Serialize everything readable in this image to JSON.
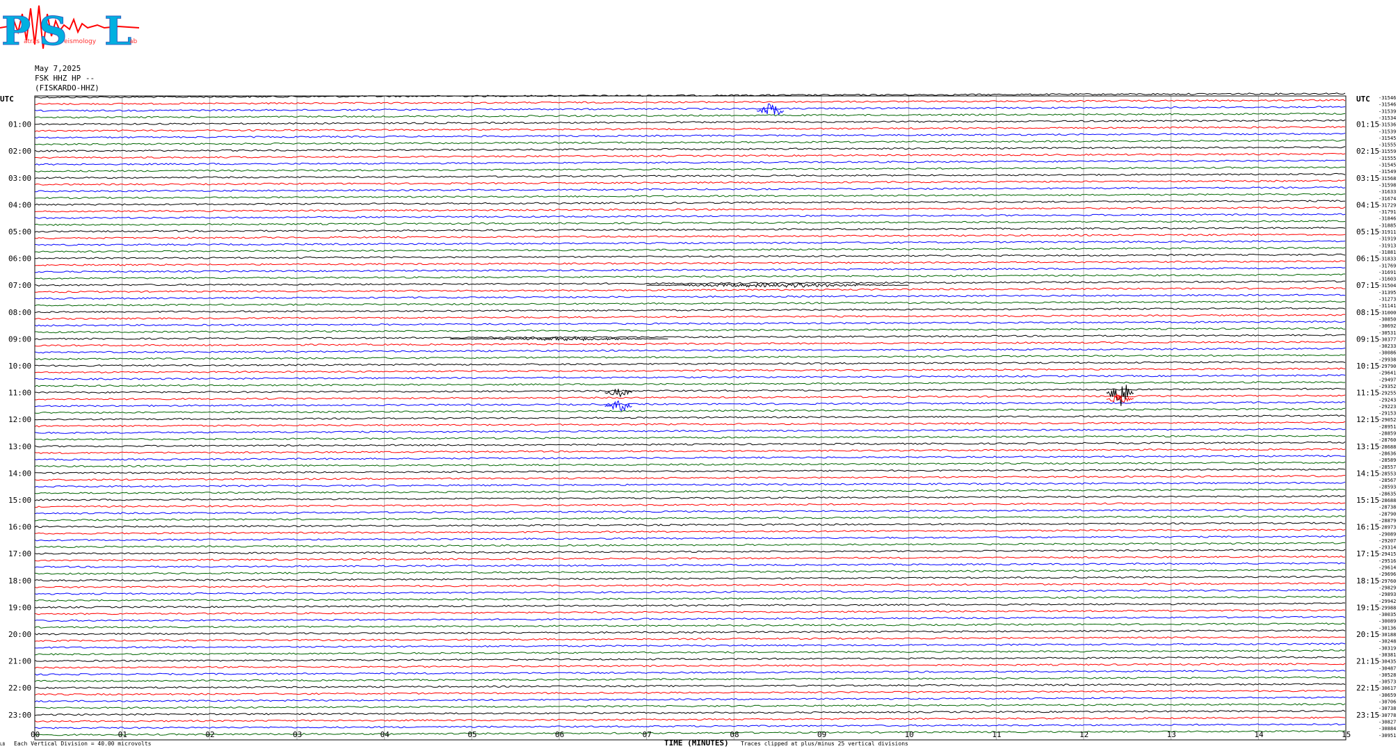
{
  "header": {
    "logo_letters": [
      "P",
      "S",
      "L"
    ],
    "logo_sub": [
      "atras",
      "eismology",
      "ab"
    ],
    "date": "May 7,2025",
    "channel": "FSK HHZ HP --",
    "station": "(FISKARDO-HHZ)"
  },
  "footer": {
    "left_mark": "LB",
    "vertical_division": "Each Vertical Division =   40.00 microvolts",
    "clip_note": "Traces clipped at plus/minus 25 vertical divisions"
  },
  "colors": {
    "black": "#000000",
    "red": "#ff0000",
    "blue": "#0000ff",
    "green": "#006400",
    "grid": "#b0b0b0"
  },
  "chart_data": {
    "type": "line",
    "title": "",
    "xlabel": "TIME (MINUTES)",
    "ylabel": "UTC",
    "ylabel_right": "UTC",
    "x_ticks": [
      "00",
      "01",
      "02",
      "03",
      "04",
      "05",
      "06",
      "07",
      "08",
      "09",
      "10",
      "11",
      "12",
      "13",
      "14",
      "15"
    ],
    "xlim": [
      0,
      15
    ],
    "trace_count": 96,
    "trace_color_cycle": [
      "#000000",
      "#ff0000",
      "#0000ff",
      "#006400"
    ],
    "left_hours": [
      "01:00",
      "02:00",
      "03:00",
      "04:00",
      "05:00",
      "06:00",
      "07:00",
      "08:00",
      "09:00",
      "10:00",
      "11:00",
      "12:00",
      "13:00",
      "14:00",
      "15:00",
      "16:00",
      "17:00",
      "18:00",
      "19:00",
      "20:00",
      "21:00",
      "22:00",
      "23:00"
    ],
    "right_hours": [
      "01:15",
      "02:15",
      "03:15",
      "04:15",
      "05:15",
      "06:15",
      "07:15",
      "08:15",
      "09:15",
      "10:15",
      "11:15",
      "12:15",
      "13:15",
      "14:15",
      "15:15",
      "16:15",
      "17:15",
      "18:15",
      "19:15",
      "20:15",
      "21:15",
      "22:15",
      "23:15"
    ],
    "right_values": [
      "-31546",
      "-31546",
      "-31539",
      "-31534",
      "-31536",
      "-31539",
      "-31545",
      "-31555",
      "-31559",
      "-31555",
      "-31545",
      "-31549",
      "-31568",
      "-31598",
      "-31633",
      "-31674",
      "-31729",
      "-31791",
      "-31846",
      "-31885",
      "-31911",
      "-31919",
      "-31913",
      "-31881",
      "-31833",
      "-31769",
      "-31691",
      "-31603",
      "-31504",
      "-31395",
      "-31273",
      "-31141",
      "-31000",
      "-30850",
      "-30692",
      "-30531",
      "-30377",
      "-30233",
      "-30086",
      "-29938",
      "-29790",
      "-29641",
      "-29497",
      "-29352",
      "-29255",
      "-29243",
      "-29223",
      "-29153",
      "-29052",
      "-28951",
      "-28859",
      "-28760",
      "-28688",
      "-28636",
      "-28589",
      "-28557",
      "-28553",
      "-28567",
      "-28593",
      "-28635",
      "-28688",
      "-28738",
      "-28790",
      "-28879",
      "-28973",
      "-29089",
      "-29207",
      "-29314",
      "-29415",
      "-29516",
      "-29614",
      "-29696",
      "-29760",
      "-29829",
      "-29893",
      "-29942",
      "-29988",
      "-30035",
      "-30089",
      "-30136",
      "-30188",
      "-30248",
      "-30319",
      "-30381",
      "-30435",
      "-30487",
      "-30528",
      "-30573",
      "-30617",
      "-30659",
      "-30706",
      "-30738",
      "-30778",
      "-30827",
      "-30884",
      "-30951"
    ],
    "events": [
      {
        "trace": 2,
        "minute": 8.42,
        "amplitude": 16
      },
      {
        "trace": 28,
        "minute": 8.5,
        "amplitude": 4,
        "duration": 3.0
      },
      {
        "trace": 36,
        "minute": 6.0,
        "amplitude": 3,
        "duration": 2.5
      },
      {
        "trace": 44,
        "minute": 6.68,
        "amplitude": 10
      },
      {
        "trace": 44,
        "minute": 12.42,
        "amplitude": 22
      },
      {
        "trace": 45,
        "minute": 12.42,
        "amplitude": 14
      },
      {
        "trace": 46,
        "minute": 6.68,
        "amplitude": 12
      }
    ]
  }
}
